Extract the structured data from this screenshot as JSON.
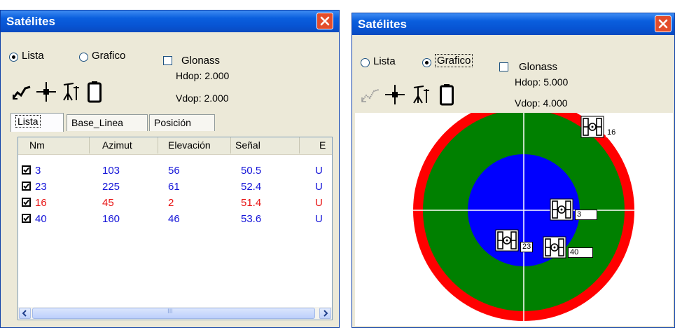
{
  "left_window": {
    "title": "Satélites",
    "mode_list_label": "Lista",
    "mode_graph_label": "Grafico",
    "selected_mode": "Lista",
    "glonass_label": "Glonass",
    "glonass_checked": false,
    "hdop": "Hdop: 2.000",
    "vdop": "Vdop: 2.000",
    "toolbar_icons": [
      "signal-graph-icon",
      "crosshair-icon",
      "antenna-icon",
      "battery-icon"
    ],
    "tabs": [
      {
        "label": "Lista",
        "active": true
      },
      {
        "label": "Base_Linea",
        "active": false
      },
      {
        "label": "Posición",
        "active": false
      }
    ],
    "columns": [
      "Nm",
      "Azimut",
      "Elevación",
      "Señal",
      "E"
    ],
    "rows": [
      {
        "nm": "3",
        "azimut": "103",
        "elevacion": "56",
        "senal": "50.5",
        "extra": "U",
        "checked": true,
        "color": "#1414d8"
      },
      {
        "nm": "23",
        "azimut": "225",
        "elevacion": "61",
        "senal": "52.4",
        "extra": "U",
        "checked": true,
        "color": "#1414d8"
      },
      {
        "nm": "16",
        "azimut": "45",
        "elevacion": "2",
        "senal": "51.4",
        "extra": "U",
        "checked": true,
        "color": "#e81414"
      },
      {
        "nm": "40",
        "azimut": "160",
        "elevacion": "46",
        "senal": "53.6",
        "extra": "U",
        "checked": true,
        "color": "#1414d8"
      }
    ],
    "scroll_thumb_grip": "III"
  },
  "right_window": {
    "title": "Satélites",
    "mode_list_label": "Lista",
    "mode_graph_label": "Grafico",
    "selected_mode": "Grafico",
    "glonass_label": "Glonass",
    "glonass_checked": false,
    "hdop": "Hdop: 5.000",
    "vdop": "Vdop: 4.000",
    "toolbar_icons": [
      "signal-graph-icon",
      "crosshair-icon",
      "antenna-icon",
      "battery-icon"
    ],
    "skyplot": {
      "ring_colors": {
        "outer": "#ff0000",
        "middle": "#008000",
        "inner": "#0000ff"
      },
      "satellites": [
        {
          "label": "16"
        },
        {
          "label": "3"
        },
        {
          "label": "23"
        },
        {
          "label": "40"
        }
      ]
    }
  },
  "colors": {
    "title_bar": "#0754d3",
    "close_button": "#e34c2b",
    "window_bg": "#ece9d8"
  }
}
